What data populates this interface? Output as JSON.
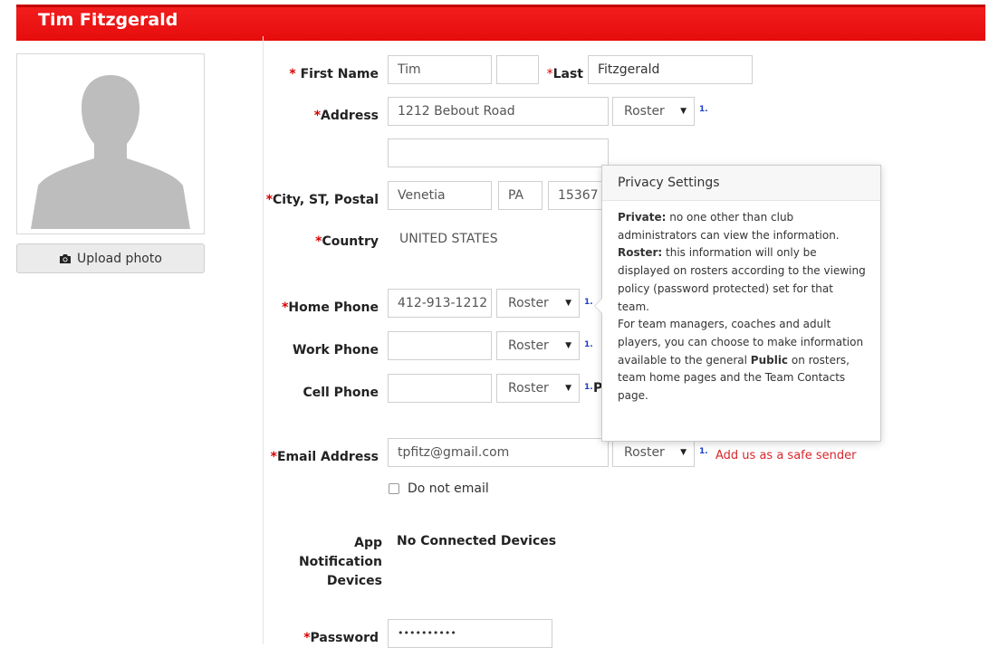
{
  "header": {
    "title": "Tim Fitzgerald"
  },
  "profile": {
    "upload_label": "Upload photo",
    "upload_icon": "camera-icon"
  },
  "required_mark": "*",
  "fields": {
    "first_name": {
      "label": "First Name",
      "first": "Tim",
      "middle": "",
      "last_label": "Last",
      "last": "Fitzgerald"
    },
    "address": {
      "label": "Address",
      "line1": "1212 Bebout Road",
      "line2": "",
      "privacy": "Roster",
      "help": "1."
    },
    "city": {
      "label": "City, ST, Postal",
      "city": "Venetia",
      "state": "PA",
      "postal": "15367"
    },
    "country": {
      "label": "Country",
      "value": "UNITED STATES"
    },
    "home_phone": {
      "label": "Home Phone",
      "value": "412-913-1212",
      "privacy": "Roster",
      "help": "1."
    },
    "work_phone": {
      "label": "Work Phone",
      "value": "",
      "privacy": "Roster",
      "help": "1."
    },
    "cell_phone": {
      "label": "Cell Phone",
      "value": "",
      "privacy": "Roster",
      "help": "1.",
      "suffix": "P"
    },
    "email": {
      "label": "Email Address",
      "value": "tpfitz@gmail.com",
      "privacy": "Roster",
      "help": "1.",
      "safe_sender": "Add us as a safe sender",
      "no_email_label": "Do not email"
    },
    "app_devices": {
      "label_line1": "App",
      "label_line2": "Notification",
      "label_line3": "Devices",
      "value": "No Connected Devices"
    },
    "password": {
      "label": "Password",
      "value": "••••••••••"
    }
  },
  "popover": {
    "title": "Privacy Settings",
    "private_term": "Private:",
    "private_text": " no one other than club administrators can view the information.",
    "roster_term": "Roster:",
    "roster_text": " this information will only be displayed on rosters according to the viewing policy (password protected) set for that team.",
    "extra_text_1": "For team managers, coaches and adult players, you can choose to make information available to the general ",
    "public_term": "Public",
    "extra_text_2": " on rosters, team home pages and the Team Contacts page."
  },
  "colors": {
    "header_red": "#e50c0c",
    "required_red": "#d60000",
    "link_red": "#d9262c",
    "help_blue": "#1a3fcc"
  }
}
